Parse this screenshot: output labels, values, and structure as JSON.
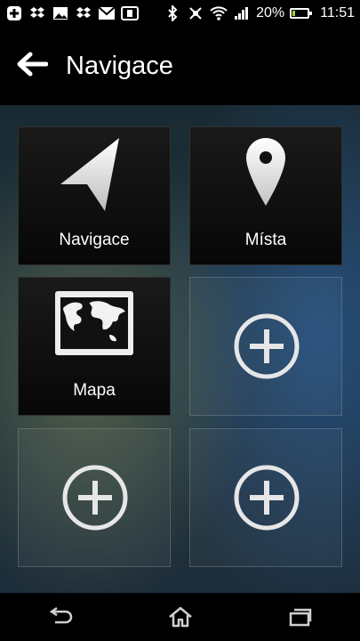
{
  "status_bar": {
    "battery_text": "20%",
    "battery_level": 0.2,
    "time": "11:51",
    "icons": [
      "plus-box-icon",
      "dropbox-icon",
      "image-icon",
      "dropbox-icon",
      "mail-icon",
      "sim-card-icon",
      "bluetooth-icon",
      "nfc-icon",
      "wifi-icon",
      "signal-icon",
      "battery-icon"
    ]
  },
  "header": {
    "title": "Navigace",
    "back_icon": "back-arrow-icon"
  },
  "tiles": [
    {
      "label": "Navigace",
      "icon": "navigation-arrow-icon"
    },
    {
      "label": "Místa",
      "icon": "map-pin-icon"
    },
    {
      "label": "Mapa",
      "icon": "world-map-icon"
    },
    {
      "label": "",
      "icon": "add-circle-icon"
    },
    {
      "label": "",
      "icon": "add-circle-icon"
    },
    {
      "label": "",
      "icon": "add-circle-icon"
    }
  ],
  "nav_bar": {
    "icons": [
      "back-icon",
      "home-icon",
      "recents-icon"
    ]
  },
  "colors": {
    "background": "#000000",
    "battery_fill": "#9bd33d",
    "text": "#ffffff"
  }
}
